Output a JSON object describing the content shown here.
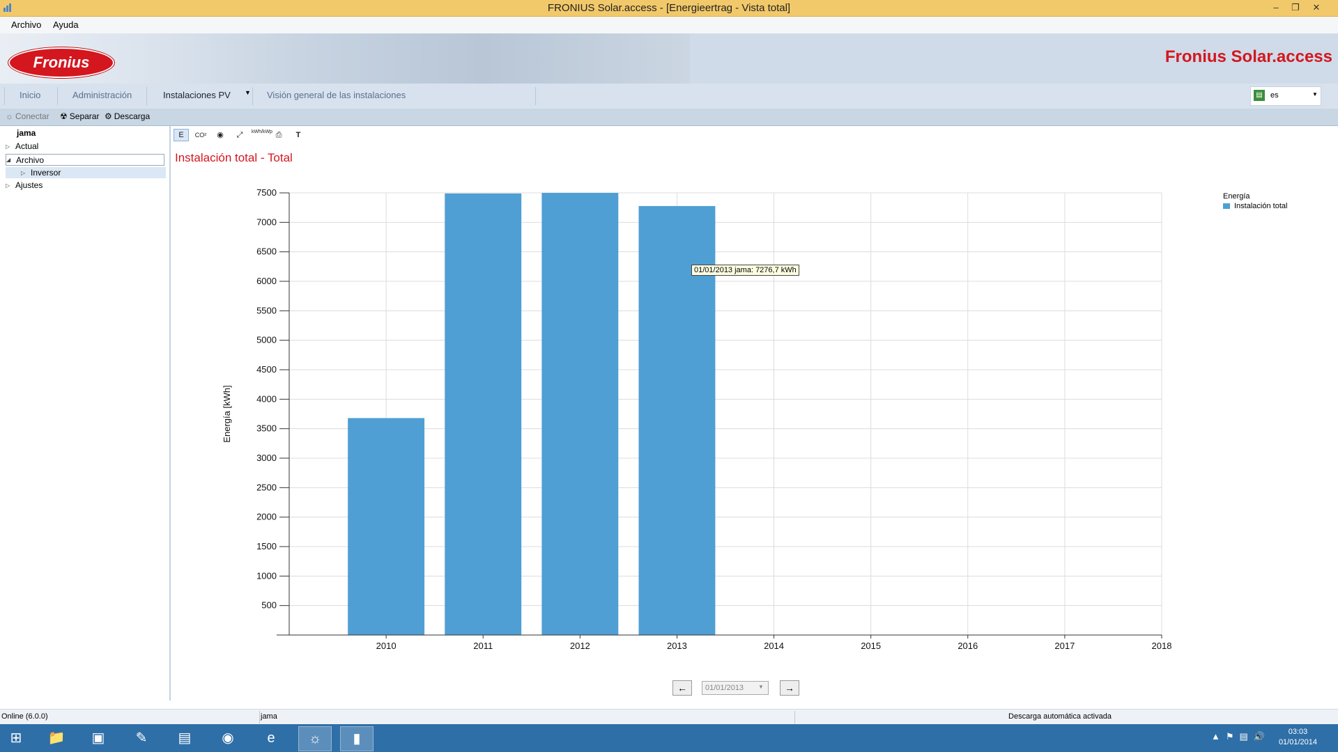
{
  "window": {
    "title": "FRONIUS Solar.access - [Energieertrag - Vista total]"
  },
  "menu": {
    "items": [
      "Archivo",
      "Ayuda"
    ]
  },
  "banner": {
    "brand": "Fronius Solar.access",
    "logo_text": "Fronius"
  },
  "tabs": [
    "Inicio",
    "Administración",
    "Instalaciones PV",
    "Visión general de las instalaciones"
  ],
  "language": {
    "selected": "es"
  },
  "toolbar": {
    "connect": "Conectar",
    "disconnect": "Separar",
    "download": "Descarga"
  },
  "tree": {
    "root": "jama",
    "items": [
      "Actual",
      "Archivo",
      "Inversor",
      "Ajustes"
    ]
  },
  "chart_tools": [
    "E",
    "CO²",
    "kWh/kWp",
    "T"
  ],
  "chart_title": "Instalación total - Total",
  "legend": {
    "title": "Energía",
    "series": "Instalación total"
  },
  "tooltip": "01/01/2013 jama: 7276,7 kWh",
  "nav": {
    "date": "01/01/2013"
  },
  "chart_data": {
    "type": "bar",
    "title": "Instalación total - Total",
    "ylabel": "Energía [kWh]",
    "xlabel": "",
    "categories": [
      "2010",
      "2011",
      "2012",
      "2013",
      "2014",
      "2015",
      "2016",
      "2017",
      "2018"
    ],
    "values": [
      3680,
      7490,
      7500,
      7276.7,
      null,
      null,
      null,
      null,
      null
    ],
    "ylim": [
      0,
      7500
    ],
    "yticks": [
      500,
      1000,
      1500,
      2000,
      2500,
      3000,
      3500,
      4000,
      4500,
      5000,
      5500,
      6000,
      6500,
      7000,
      7500
    ],
    "grid": true,
    "legend": "top-right",
    "color": "#4f9fd4"
  },
  "status": {
    "left": "Online (6.0.0)",
    "middle": "jama",
    "right": "Descarga automática activada"
  },
  "taskbar": {
    "time": "03:03",
    "date": "01/01/2014"
  }
}
